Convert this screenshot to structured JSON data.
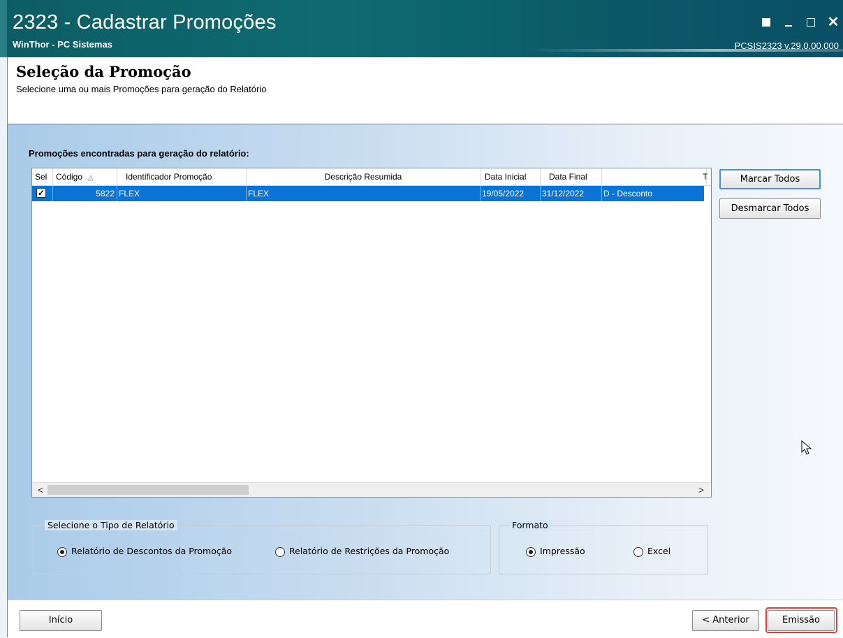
{
  "window": {
    "title": "2323 - Cadastrar Promoções",
    "subtitle": "WinThor - PC Sistemas",
    "version": "PCSIS2323  v.29.0.00.000"
  },
  "header": {
    "title": "Seleção da Promoção",
    "description": "Selecione uma ou mais Promoções para geração do Relatório"
  },
  "grid": {
    "label": "Promoções encontradas para geração do relatório:",
    "columns": [
      "Sel",
      "Código",
      "Identificador Promoção",
      "Descrição Resumida",
      "Data Inicial",
      "Data Final",
      "",
      "T"
    ],
    "rows": [
      {
        "sel": "✓",
        "codigo": "5822",
        "identificador": "FLEX",
        "descricao": "FLEX",
        "data_inicial": "19/05/2022",
        "data_final": "31/12/2022",
        "tipo": "D - Desconto"
      }
    ]
  },
  "buttons": {
    "marcar_todos": "Marcar Todos",
    "desmarcar_todos": "Desmarcar Todos",
    "inicio": "Início",
    "anterior": "< Anterior",
    "emissao": "Emissão"
  },
  "tipo_relatorio": {
    "legend": "Selecione o Tipo de Relatório",
    "options": [
      "Relatório de Descontos da Promoção",
      "Relatório de Restrições da Promoção"
    ],
    "selected": 0
  },
  "formato": {
    "legend": "Formato",
    "options": [
      "Impressão",
      "Excel"
    ],
    "selected": 0
  },
  "colors": {
    "selection": "#0a74d6",
    "titlebar": "#0f6b72",
    "highlight": "#d9433f"
  }
}
